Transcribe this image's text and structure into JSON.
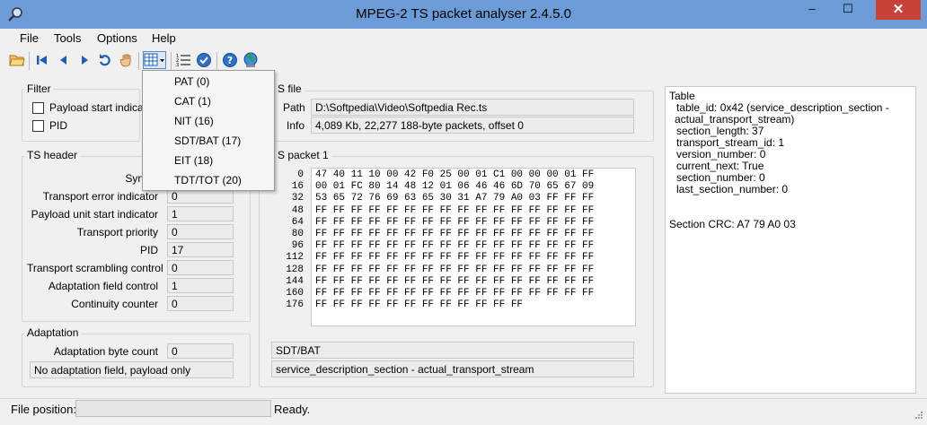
{
  "window": {
    "title": "MPEG-2 TS packet analyser 2.4.5.0",
    "minimize": "–",
    "maximize": "☐",
    "close": "✕"
  },
  "menu": [
    "File",
    "Tools",
    "Options",
    "Help"
  ],
  "dropdown": [
    "PAT (0)",
    "CAT (1)",
    "NIT (16)",
    "SDT/BAT (17)",
    "EIT (18)",
    "TDT/TOT (20)"
  ],
  "filter": {
    "label": "Filter",
    "payload_start": "Payload start indicator",
    "pid": "PID"
  },
  "ts_file": {
    "label": "S file",
    "path_label": "Path",
    "path": "D:\\Softpedia\\Video\\Softpedia Rec.ts",
    "info_label": "Info",
    "info": "4,089 Kb, 22,277 188-byte packets, offset 0"
  },
  "ts_header": {
    "label": "TS header",
    "rows": [
      {
        "label": "Sync b",
        "value": ""
      },
      {
        "label": "Transport error indicator",
        "value": "0"
      },
      {
        "label": "Payload unit start indicator",
        "value": "1"
      },
      {
        "label": "Transport priority",
        "value": "0"
      },
      {
        "label": "PID",
        "value": "17"
      },
      {
        "label": "Transport scrambling control",
        "value": "0"
      },
      {
        "label": "Adaptation field control",
        "value": "1"
      },
      {
        "label": "Continuity counter",
        "value": "0"
      }
    ]
  },
  "adaptation": {
    "label": "Adaptation",
    "byte_count_label": "Adaptation byte count",
    "byte_count": "0",
    "note": "No adaptation field, payload only"
  },
  "packet": {
    "label": "S packet 1",
    "offsets": [
      "0",
      "16",
      "32",
      "48",
      "64",
      "80",
      "96",
      "112",
      "128",
      "144",
      "160",
      "176"
    ],
    "rows": [
      "47 40 11 10 00 42 F0 25 00 01 C1 00 00 00 01 FF",
      "00 01 FC 80 14 48 12 01 06 46 46 6D 70 65 67 09",
      "53 65 72 76 69 63 65 30 31 A7 79 A0 03 FF FF FF",
      "FF FF FF FF FF FF FF FF FF FF FF FF FF FF FF FF",
      "FF FF FF FF FF FF FF FF FF FF FF FF FF FF FF FF",
      "FF FF FF FF FF FF FF FF FF FF FF FF FF FF FF FF",
      "FF FF FF FF FF FF FF FF FF FF FF FF FF FF FF FF",
      "FF FF FF FF FF FF FF FF FF FF FF FF FF FF FF FF",
      "FF FF FF FF FF FF FF FF FF FF FF FF FF FF FF FF",
      "FF FF FF FF FF FF FF FF FF FF FF FF FF FF FF FF",
      "FF FF FF FF FF FF FF FF FF FF FF FF FF FF FF FF",
      "FF FF FF FF FF FF FF FF FF FF FF FF"
    ],
    "table_name": "SDT/BAT",
    "section_desc": "service_description_section - actual_transport_stream"
  },
  "table_panel": {
    "lines": [
      "Table",
      "table_id: 0x42 (service_description_section -",
      "actual_transport_stream)",
      "section_length: 37",
      "transport_stream_id: 1",
      "version_number: 0",
      "current_next: True",
      "section_number: 0",
      "last_section_number: 0"
    ],
    "crc": "Section CRC: A7 79 A0 03"
  },
  "status": {
    "file_position_label": "File position:",
    "message": "Ready."
  },
  "colors": {
    "titlebar": "#6b9cd7",
    "close": "#c7433a",
    "icon_blue": "#1a5fb4",
    "icon_orange": "#e8a33a"
  }
}
